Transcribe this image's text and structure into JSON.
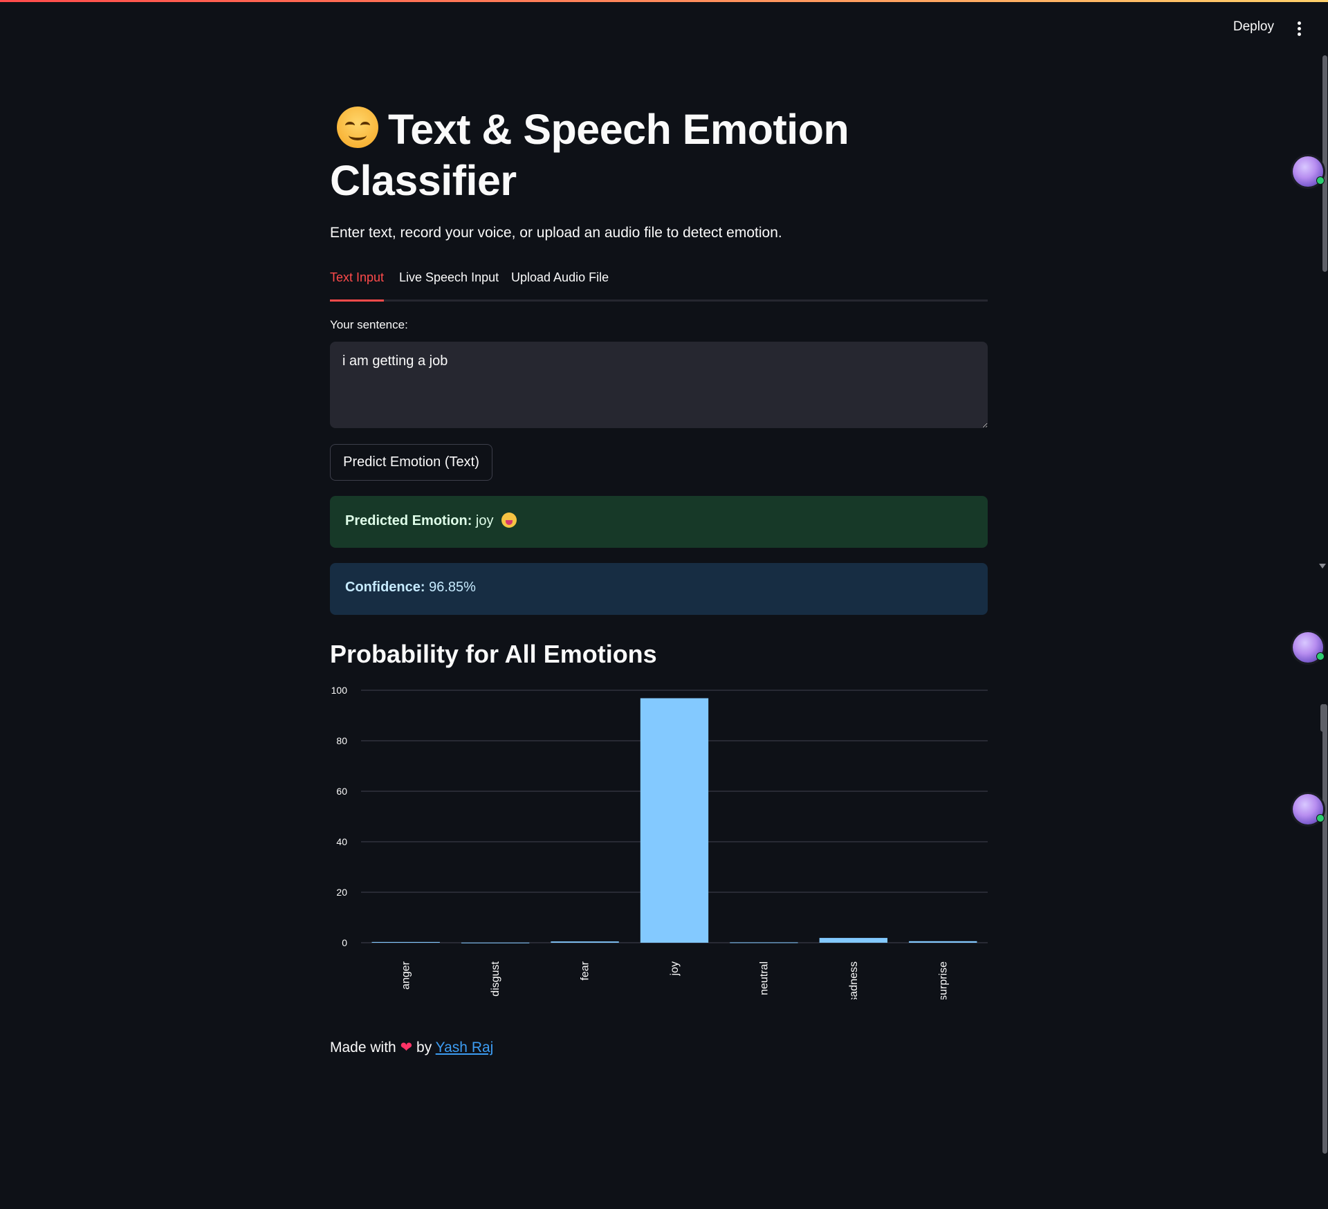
{
  "header": {
    "deploy_label": "Deploy"
  },
  "page": {
    "title": "Text & Speech Emotion Classifier",
    "subtitle": "Enter text, record your voice, or upload an audio file to detect emotion."
  },
  "tabs": [
    {
      "label": "Text Input",
      "active": true
    },
    {
      "label": "Live Speech Input",
      "active": false
    },
    {
      "label": "Upload Audio File",
      "active": false
    }
  ],
  "form": {
    "label": "Your sentence:",
    "value": "i am getting a job",
    "predict_label": "Predict Emotion (Text)"
  },
  "result": {
    "emotion_label": "Predicted Emotion:",
    "emotion_value": "joy",
    "confidence_label": "Confidence:",
    "confidence_value": "96.85%"
  },
  "chart_section": {
    "heading": "Probability for All Emotions"
  },
  "chart_data": {
    "type": "bar",
    "categories": [
      "anger",
      "disgust",
      "fear",
      "joy",
      "neutral",
      "sadness",
      "surprise"
    ],
    "values": [
      0.3,
      0.05,
      0.5,
      96.85,
      0.15,
      1.9,
      0.6
    ],
    "ylim": [
      0,
      100
    ],
    "yticks": [
      "0",
      "20",
      "40",
      "60",
      "80",
      "100"
    ],
    "bar_color": "#83c9ff",
    "grid": true
  },
  "footer": {
    "prefix": "Made with",
    "by": "by",
    "author": "Yash Raj"
  },
  "colors": {
    "accent": "#ff4b4b",
    "background": "#0e1117",
    "success_bg": "#173928",
    "info_bg": "#172d43"
  }
}
